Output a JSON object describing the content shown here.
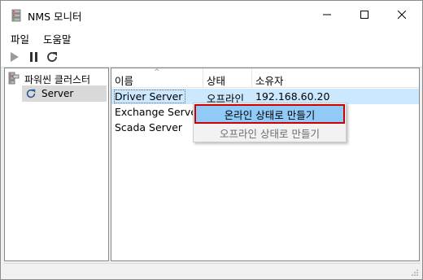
{
  "window": {
    "title": "NMS 모니터",
    "icon": "server-app-icon"
  },
  "menu": {
    "items": [
      {
        "label": "파일"
      },
      {
        "label": "도움말"
      }
    ]
  },
  "toolbar": {
    "buttons": [
      {
        "name": "play-icon",
        "enabled": false
      },
      {
        "name": "pause-icon",
        "enabled": true
      },
      {
        "name": "refresh-icon",
        "enabled": true
      }
    ]
  },
  "tree": {
    "root_label": "파워씬 클러스터",
    "child_label": "Server"
  },
  "list": {
    "columns": [
      "이름",
      "상태",
      "소유자"
    ],
    "sort_indicator": "^",
    "rows": [
      {
        "name": "Driver Server",
        "status": "오프라인",
        "owner": "192.168.60.20"
      },
      {
        "name": "Exchange Server",
        "status": "",
        "owner": ""
      },
      {
        "name": "Scada Server",
        "status": "",
        "owner": ""
      }
    ]
  },
  "context_menu": {
    "items": [
      {
        "label": "온라인 상태로 만들기",
        "enabled": true
      },
      {
        "label": "오프라인 상태로 만들기",
        "enabled": false
      }
    ]
  },
  "colors": {
    "selection": "#cce8ff",
    "menu_highlight": "#91c9f7",
    "highlight_border": "#cc0000"
  }
}
